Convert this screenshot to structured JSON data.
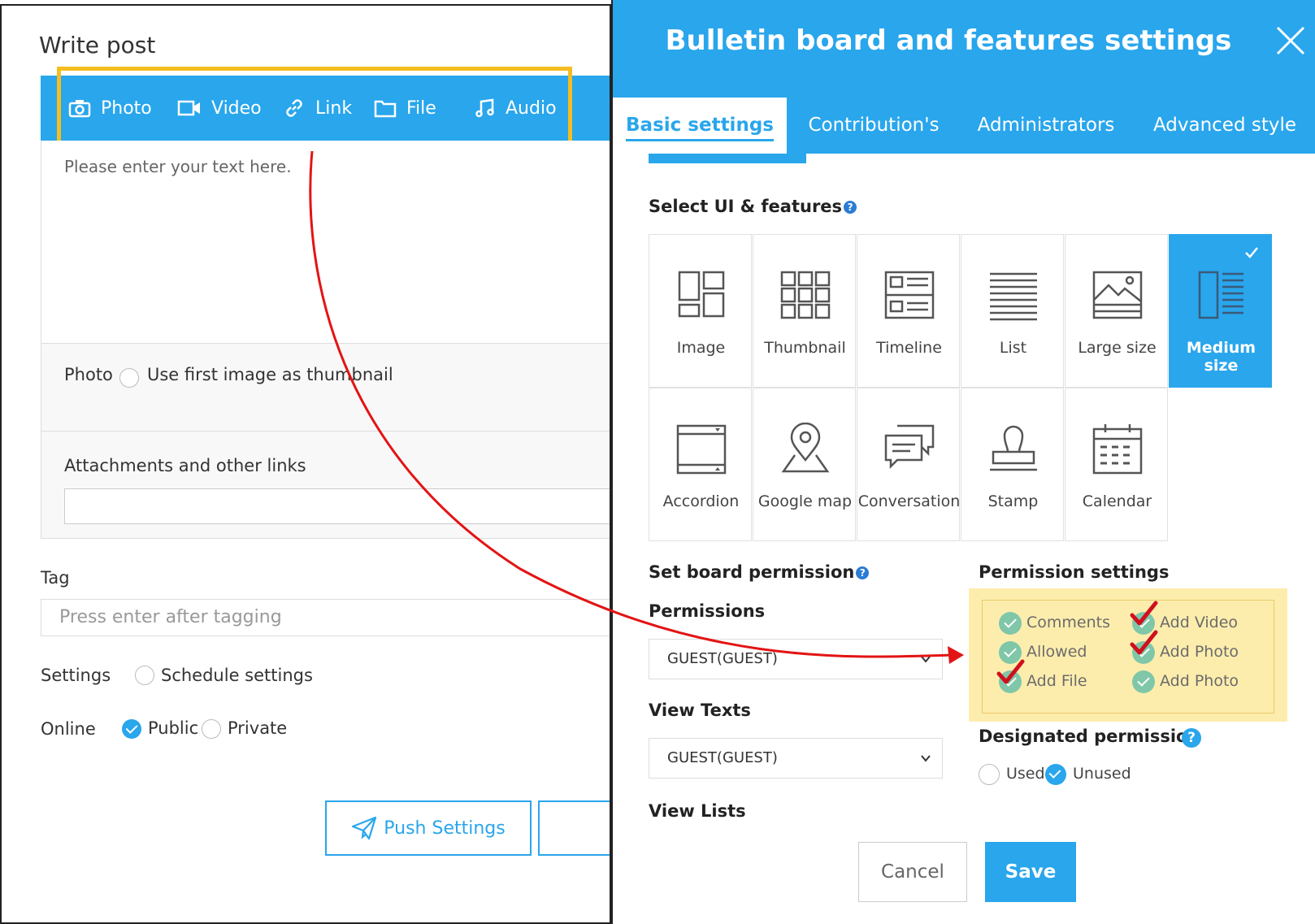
{
  "write_post": {
    "title": "Write post",
    "toolbar": [
      {
        "label": "Photo",
        "icon": "camera-icon"
      },
      {
        "label": "Video",
        "icon": "video-icon"
      },
      {
        "label": "Link",
        "icon": "link-icon"
      },
      {
        "label": "File",
        "icon": "folder-icon"
      },
      {
        "label": "Audio",
        "icon": "music-icon"
      }
    ],
    "editor_placeholder": "Please enter your text here.",
    "photo_label": "Photo",
    "photo_option": "Use first image as thumbnail",
    "attachments_label": "Attachments and other links",
    "tag_label": "Tag",
    "tag_placeholder": "Press enter after tagging",
    "settings_label": "Settings",
    "schedule_option": "Schedule settings",
    "online_label": "Online",
    "public_option": "Public",
    "private_option": "Private",
    "online_selected": "Public",
    "push_button": "Push Settings"
  },
  "modal": {
    "title": "Bulletin board and features settings",
    "tabs": [
      {
        "label": "Basic settings",
        "active": true
      },
      {
        "label": "Contribution's",
        "active": false
      },
      {
        "label": "Administrators",
        "active": false
      },
      {
        "label": "Advanced style",
        "active": false
      }
    ],
    "select_ui_heading": "Select UI & features",
    "ui_options": [
      {
        "label": "Image",
        "icon": "image-layout-icon"
      },
      {
        "label": "Thumbnail",
        "icon": "thumbnail-grid-icon"
      },
      {
        "label": "Timeline",
        "icon": "timeline-icon"
      },
      {
        "label": "List",
        "icon": "list-icon"
      },
      {
        "label": "Large size",
        "icon": "large-size-icon"
      },
      {
        "label": "Medium size",
        "icon": "medium-size-icon",
        "selected": true
      },
      {
        "label": "Accordion",
        "icon": "accordion-icon"
      },
      {
        "label": "Google map",
        "icon": "map-pin-icon"
      },
      {
        "label": "Conversation",
        "icon": "conversation-icon"
      },
      {
        "label": "Stamp",
        "icon": "stamp-icon"
      },
      {
        "label": "Calendar",
        "icon": "calendar-icon"
      }
    ],
    "board_permission_heading": "Set board permission",
    "permissions_label": "Permissions",
    "permissions_value": "GUEST(GUEST)",
    "view_texts_label": "View Texts",
    "view_texts_value": "GUEST(GUEST)",
    "view_lists_label": "View Lists",
    "permission_settings_heading": "Permission settings",
    "permission_items": [
      {
        "label": "Comments",
        "red_tick": false
      },
      {
        "label": "Add Video",
        "red_tick": true
      },
      {
        "label": "Allowed",
        "red_tick": false
      },
      {
        "label": "Add Photo",
        "red_tick": true
      },
      {
        "label": "Add File",
        "red_tick": true
      },
      {
        "label": "Add Photo",
        "red_tick": false
      }
    ],
    "designated_heading": "Designated permission",
    "designated_options": [
      "Used",
      "Unused"
    ],
    "designated_selected": "Unused",
    "cancel_button": "Cancel",
    "save_button": "Save"
  },
  "colors": {
    "accent": "#29a6ec",
    "highlight_border": "#f5bd1f",
    "permission_bg": "#fdedad",
    "annotation_arrow": "#e31414"
  }
}
